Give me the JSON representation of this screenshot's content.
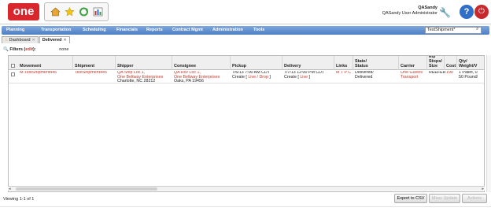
{
  "app": {
    "logo": "one",
    "user_name": "QASandy",
    "user_role": "QASandy User Administrator"
  },
  "nav": {
    "items": [
      "Planning",
      "Transportation",
      "Scheduling",
      "Financials",
      "Reports",
      "Contract Mgmt",
      "Administration",
      "Tools"
    ],
    "search_value": "TestShipment*"
  },
  "tabs": [
    {
      "label": "Dashboard"
    },
    {
      "label": "Delivered"
    }
  ],
  "filters": {
    "label": "Filters (",
    "edit": "edit",
    "label_end": "):",
    "value": "none"
  },
  "grid": {
    "columns": [
      "Movement",
      "Shipment",
      "Shipper",
      "Consignee",
      "Pickup",
      "Delivery",
      "Links",
      "State/\nStatus",
      "Carrier",
      "Eq/\nStops/\nSize",
      "Cost",
      "Qty/\nWeight/V"
    ],
    "row": {
      "movement": "M-TestShipment445",
      "shipment": "TestShipment445",
      "shipper_1": "QA Ship Loc 1,",
      "shipper_2": "One Beltway Enterprises",
      "shipper_3": "Charlotte, NC 28212",
      "consignee_1": "QA Rcv Loc 1,",
      "consignee_2": "One Beltway Enterprises",
      "consignee_3": "Oaks, PA 19456",
      "pickup_1": "7/6/13 7:00 AM CDT",
      "pickup_2a": "Create [ ",
      "pickup_2b": "Live / Drop",
      "pickup_2c": " ]",
      "delivery_1": "7/7/13 12:00 PM CDT",
      "delivery_2a": "Create [ ",
      "delivery_2b": "Live",
      "delivery_2c": " ]",
      "links": "M T P C",
      "state_1": "Delivered/",
      "state_2": "Delivered",
      "carrier_1": "One Gustov",
      "carrier_2": "Transport",
      "eq": "REEFER",
      "cost": "190",
      "qty_1": "1 Pallet, 0",
      "qty_2": "50 Pound/"
    }
  },
  "footer": {
    "viewing": "Viewing 1-1 of 1",
    "export": "Export to CSV",
    "mass_update": "Mass Update",
    "actions": "Actions"
  },
  "colors": {
    "brand_red": "#d9272e",
    "nav_blue": "#4d7ec3",
    "link_red": "#c0392b"
  }
}
